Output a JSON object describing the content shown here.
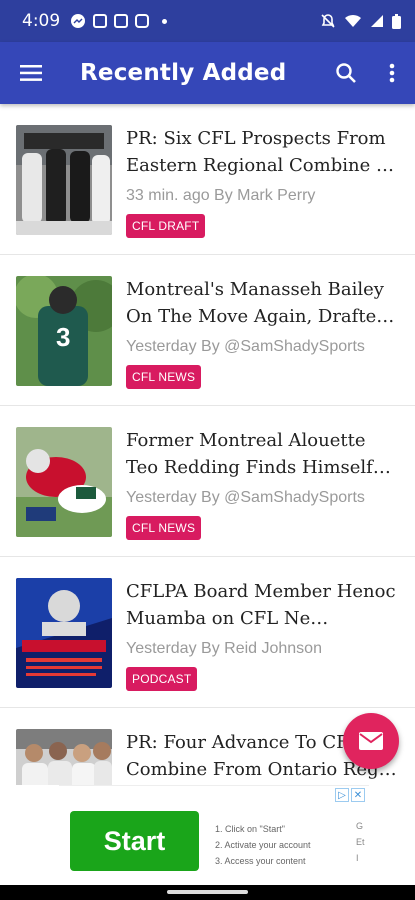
{
  "status_bar": {
    "time": "4:09"
  },
  "app_bar": {
    "title": "Recently Added"
  },
  "articles": [
    {
      "headline": "PR: Six CFL Prospects From Eastern Regional Combine …",
      "meta": "33 min. ago By Mark Perry",
      "tag": "CFL DRAFT"
    },
    {
      "headline": "Montreal's Manasseh Bailey On The Move Again, Drafte…",
      "meta": "Yesterday By @SamShadySports",
      "tag": "CFL NEWS"
    },
    {
      "headline": "Former Montreal Alouette Teo Redding Finds Himself…",
      "meta": "Yesterday By @SamShadySports",
      "tag": "CFL NEWS"
    },
    {
      "headline": "CFLPA Board Member Henoc Muamba on CFL Ne…",
      "meta": "Yesterday By Reid Johnson",
      "tag": "PODCAST"
    },
    {
      "headline": "PR: Four Advance To CFL Combine From Ontario Reg…",
      "meta": "",
      "tag": ""
    }
  ],
  "ad": {
    "start_label": "Start",
    "steps": [
      "1. Click on \"Start\"",
      "2. Activate your account",
      "3. Access your content"
    ],
    "cut_text": [
      "G",
      "Et",
      "I"
    ]
  },
  "colors": {
    "status_bar": "#2e3f9e",
    "app_bar": "#3547b8",
    "tag": "#d81b60",
    "fab": "#e0245e",
    "ad_button": "#1aa51a"
  }
}
